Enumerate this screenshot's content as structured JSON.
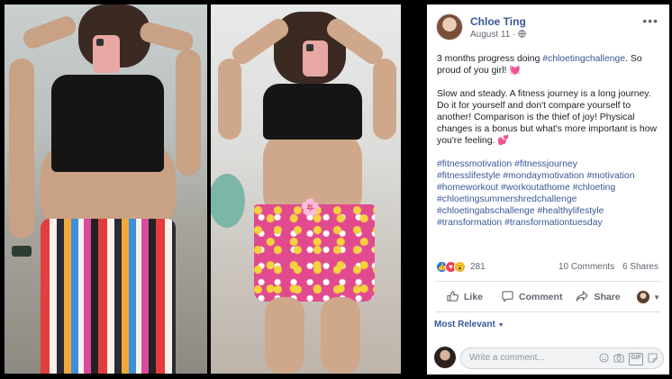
{
  "post": {
    "author": "Chloe Ting",
    "date": "August 11",
    "date_separator": "·",
    "audience_icon": "globe-icon",
    "menu_icon": "more-horizontal-icon",
    "paragraph1": "3 months progress doing ",
    "paragraph1_tag": "#chloetingchallenge",
    "paragraph1_end": ". So proud of you girl! ",
    "paragraph1_emoji": "💓",
    "paragraph2": "Slow and steady. A fitness journey is a long journey. Do it for yourself and don't compare yourself to another! Comparison is the thief of joy! Physical changes is a bonus but what's more important is how you're feeling. ",
    "paragraph2_emoji": "💕",
    "hashtags": [
      "#fitnessmotivation",
      "#fitnessjourney",
      "#fitnesslifestyle",
      "#mondaymotivation",
      "#motivation",
      "#homeworkout",
      "#workoutathome",
      "#chloeting",
      "#chloetingsummershredchallenge",
      "#chloetingabschallenge",
      "#healthylifestyle",
      "#transformation",
      "#transformationtuesday"
    ]
  },
  "stats": {
    "reaction_count": "281",
    "comments": "10 Comments",
    "shares": "6 Shares"
  },
  "actions": {
    "like": "Like",
    "comment": "Comment",
    "share": "Share"
  },
  "comments_section": {
    "sort_label": "Most Relevant",
    "placeholder": "Write a comment..."
  },
  "photo": {
    "censor_emoji": "🌸"
  },
  "colors": {
    "link": "#385898",
    "like_blue": "#1877f2",
    "love_red": "#f33e58",
    "wow_yellow": "#f7b125"
  }
}
